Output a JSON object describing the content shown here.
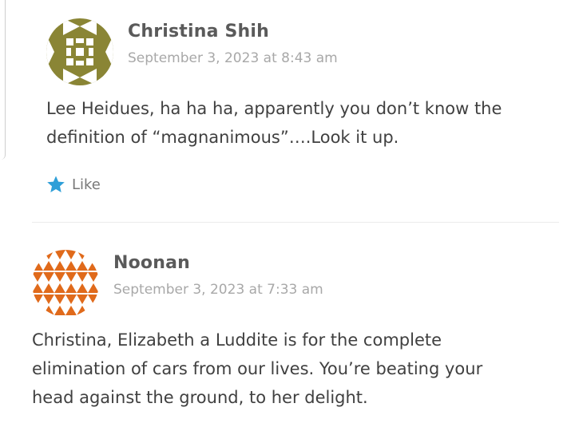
{
  "comments": [
    {
      "author": "Christina Shih",
      "timestamp": "September 3, 2023 at 8:43 am",
      "body_line_1": "Lee Heidues, ha ha ha, apparently you don’t know the",
      "body_line_2": "definition of “magnanimous”….Look it up.",
      "like_label": "Like",
      "avatar_color": "#8a8535"
    },
    {
      "author": "Noonan",
      "timestamp": "September 3, 2023 at 7:33 am",
      "body_line_1": "Christina, Elizabeth a Luddite is for the complete",
      "body_line_2": "elimination of cars from our lives. You’re beating your",
      "body_line_3": "head against the ground, to her delight.",
      "avatar_color": "#e06a1b"
    }
  ],
  "colors": {
    "star": "#2e9fd8",
    "author": "#5a5a5a",
    "timestamp": "#a8a8a8",
    "body": "#404040"
  },
  "icons": {
    "like": "star-icon"
  }
}
